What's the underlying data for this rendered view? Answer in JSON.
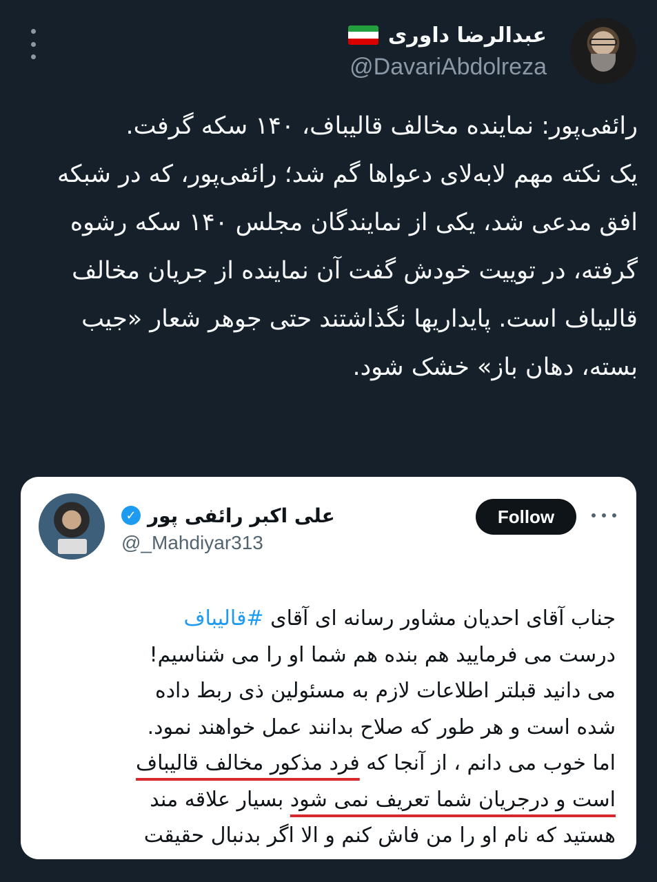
{
  "header": {
    "display_name": "عبدالرضا داوری",
    "flag_icon": "iran-flag-icon",
    "handle": "@DavariAbdolreza",
    "more_icon": "more-vertical-icon"
  },
  "tweet": {
    "text": "رائفی‌پور: نماینده مخالف قالیباف، ۱۴۰ سکه گرفت.\nیک نکته مهم لابه‌لای دعواها گم شد؛ رائفی‌پور، که در شبکه افق مدعی شد، یکی از نمایندگان مجلس ۱۴۰ سکه رشوه گرفته، در توییت خودش گفت آن نماینده از جریان مخالف قالیباف است. پایداریها نگذاشتند حتی جوهر شعار «جیب بسته، دهان باز» خشک شود."
  },
  "quoted": {
    "display_name": "علی اکبر رائفی پور",
    "handle": "@_Mahdiyar313",
    "follow_label": "Follow",
    "verified_color": "#1d9bf0",
    "lines": {
      "l1_prefix": "جناب آقای احدیان مشاور رسانه ای آقای ",
      "l1_hashtag": "#قالیباف",
      "l2": "درست می فرمایید هم بنده هم شما او را می شناسیم!",
      "l3": "می دانید قبلتر اطلاعات لازم به مسئولین ذی ربط داده",
      "l4": "شده است و هر طور که صلاح بدانند عمل خواهند نمود.",
      "l5_prefix": "اما خوب می دانم ، از آنجا که ",
      "l5_underlined": "فرد مذکور مخالف قالیباف",
      "l6_underlined_a": "است و درجریان شما تعریف نمی شود",
      "l6_suffix": " بسیار علاقه مند",
      "l7": "هستید که نام او را من فاش کنم و الا اگر بدنبال حقیقت"
    },
    "underline_color": "#d6282d"
  }
}
